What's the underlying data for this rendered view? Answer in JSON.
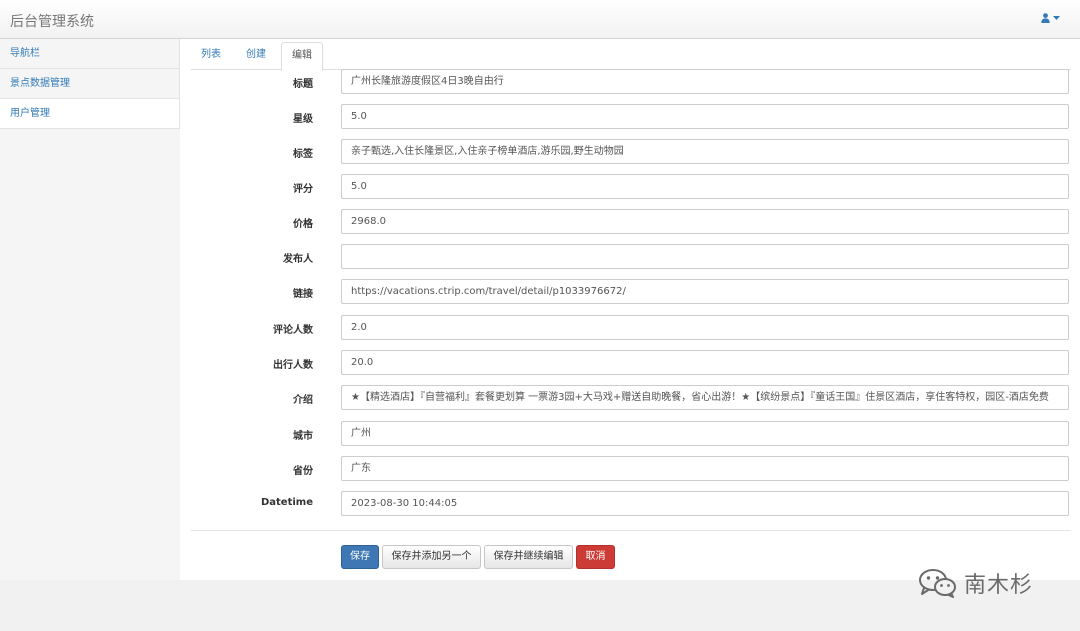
{
  "app": {
    "title": "后台管理系统"
  },
  "sidebar": {
    "items": [
      {
        "label": "导航栏"
      },
      {
        "label": "景点数据管理"
      },
      {
        "label": "用户管理"
      }
    ]
  },
  "tabs": [
    {
      "label": "列表"
    },
    {
      "label": "创建"
    },
    {
      "label": "编辑"
    }
  ],
  "form": {
    "fields": [
      {
        "label": "标题",
        "value": "广州长隆旅游度假区4日3晚自由行"
      },
      {
        "label": "星级",
        "value": "5.0"
      },
      {
        "label": "标签",
        "value": "亲子甄选,入住长隆景区,入住亲子榜单酒店,游乐园,野生动物园"
      },
      {
        "label": "评分",
        "value": "5.0"
      },
      {
        "label": "价格",
        "value": "2968.0"
      },
      {
        "label": "发布人",
        "value": ""
      },
      {
        "label": "链接",
        "value": "https://vacations.ctrip.com/travel/detail/p1033976672/"
      },
      {
        "label": "评论人数",
        "value": "2.0"
      },
      {
        "label": "出行人数",
        "value": "20.0"
      },
      {
        "label": "介绍",
        "value": "★【精选酒店】『自营福利』套餐更划算 一票游3园+大马戏+赠送自助晚餐，省心出游！★【缤纷景点】『童话王国』住景区酒店，享住客特权，园区-酒店免费"
      },
      {
        "label": "城市",
        "value": "广州"
      },
      {
        "label": "省份",
        "value": "广东"
      },
      {
        "label": "Datetime",
        "value": "2023-08-30 10:44:05"
      }
    ]
  },
  "actions": {
    "save": "保存",
    "save_add": "保存并添加另一个",
    "save_continue": "保存并继续编辑",
    "cancel": "取消"
  },
  "watermark": {
    "text": "南木杉"
  },
  "colors": {
    "link": "#337ab7",
    "primary": "#3e77b3",
    "danger": "#cc3b36"
  }
}
